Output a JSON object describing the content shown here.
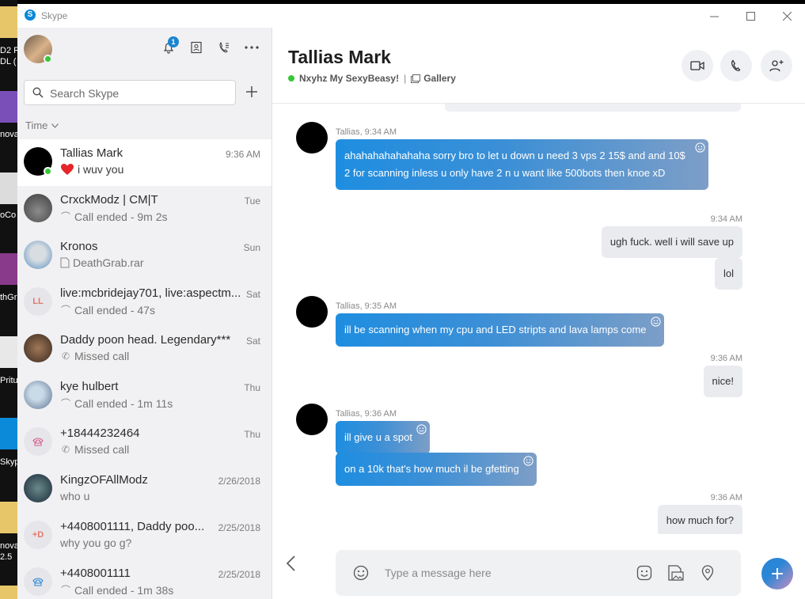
{
  "desktop": {
    "labels": [
      "D2 R",
      "DL (",
      "nova",
      "oCo",
      "thGr",
      "Pritu",
      "Skyp",
      "nova",
      "2.5"
    ]
  },
  "window": {
    "title": "Skype",
    "minimize_label": "─",
    "maximize_label": "☐",
    "close_label": "✕"
  },
  "sidebar": {
    "notification_count": "1",
    "search_placeholder": "Search Skype",
    "sort_label": "Time",
    "conversations": [
      {
        "name": "Tallias Mark",
        "time": "9:36 AM",
        "preview": "i wuv you",
        "preview_icon": "heart-icon",
        "active": true
      },
      {
        "name": "CrxckModz | CM|T",
        "time": "Tue",
        "preview": "Call ended - 9m 2s",
        "preview_icon": "call-ended-icon"
      },
      {
        "name": "Kronos",
        "time": "Sun",
        "preview": "DeathGrab.rar",
        "preview_icon": "file-icon"
      },
      {
        "name": "live:mcbridejay701, live:aspectm...",
        "time": "Sat",
        "preview": "Call ended - 47s",
        "preview_icon": "call-ended-icon",
        "initials": "LL"
      },
      {
        "name": "Daddy poon head. Legendary***",
        "time": "Sat",
        "preview": "Missed call",
        "preview_icon": "missed-call-icon"
      },
      {
        "name": "kye hulbert",
        "time": "Thu",
        "preview": "Call ended - 1m 11s",
        "preview_icon": "call-ended-icon"
      },
      {
        "name": "+18444232464",
        "time": "Thu",
        "preview": "Missed call",
        "preview_icon": "missed-call-icon"
      },
      {
        "name": "KingzOFAllModz",
        "time": "2/26/2018",
        "preview": "who u",
        "preview_icon": ""
      },
      {
        "name": "+4408001111, Daddy poo...",
        "time": "2/25/2018",
        "preview": "why you go g?",
        "preview_icon": "",
        "initials": "+D"
      },
      {
        "name": "+4408001111",
        "time": "2/25/2018",
        "preview": "Call ended - 1m 38s",
        "preview_icon": "call-ended-icon"
      }
    ]
  },
  "chat": {
    "title": "Tallias Mark",
    "mood": "Nxyhz My SexyBeasy!",
    "separator": "|",
    "gallery_label": "Gallery",
    "messages": {
      "m1_meta": "Tallias, 9:34 AM",
      "m1_text": "ahahahahahahaha sorry bro to let u down u need 3 vps 2 15$ and and 10$ 2 for scanning inless u only have 2 n u want like 500bots then  knoe xD",
      "o1_time": "9:34 AM",
      "o1_text": "ugh fuck. well i will save up",
      "o2_text": "lol",
      "m2_meta": "Tallias, 9:35 AM",
      "m2_text": "ill be scanning when my cpu and LED stripts and lava lamps come",
      "o3_time": "9:36 AM",
      "o3_text": "nice!",
      "m3_meta": "Tallias, 9:36 AM",
      "m3_text": "ill give u a spot",
      "m4_text": "on a 10k that's how much il be gfetting",
      "o4_time": "9:36 AM",
      "o4_text": "how much for?"
    },
    "composer_placeholder": "Type a message here"
  },
  "colors": {
    "accent": "#1a85d0",
    "online": "#37c837"
  }
}
